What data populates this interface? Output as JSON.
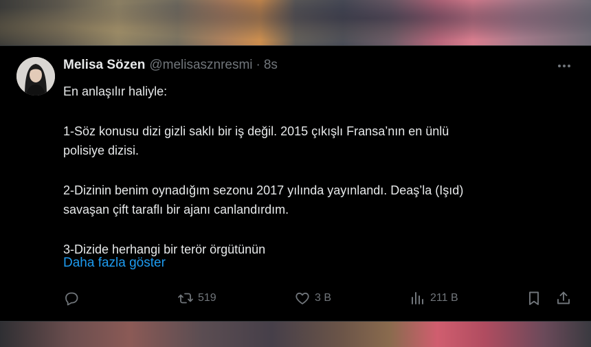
{
  "tweet": {
    "author_name": "Melisa Sözen",
    "handle": "@melisasznresmi",
    "separator": "·",
    "time": "8s",
    "lines": {
      "intro": "En anlaşılır haliyle:",
      "p1a": "1-Söz konusu dizi gizli saklı bir iş değil. 2015 çıkışlı Fransa’nın en ünlü",
      "p1b": "polisiye dizisi.",
      "p2a": "2-Dizinin benim oynadığım sezonu 2017 yılında yayınlandı. Deaş’la (Işıd)",
      "p2b": "savaşan çift taraflı bir ajanı canlandırdım.",
      "p3a": "3-Dizide herhangi bir terör örgütünün"
    },
    "show_more": "Daha fazla göster",
    "stats": {
      "replies": "",
      "reposts": "519",
      "likes": "3 B",
      "views": "211 B"
    }
  },
  "icons": {
    "reply": "reply-icon",
    "repost": "repost-icon",
    "like": "heart-icon",
    "views": "views-chart-icon",
    "bookmark": "bookmark-icon",
    "share": "share-icon",
    "more": "more-dots-icon"
  },
  "colors": {
    "background": "#000000",
    "primary_text": "#e7e9ea",
    "secondary_text": "#71767b",
    "link": "#1d9bf0"
  }
}
